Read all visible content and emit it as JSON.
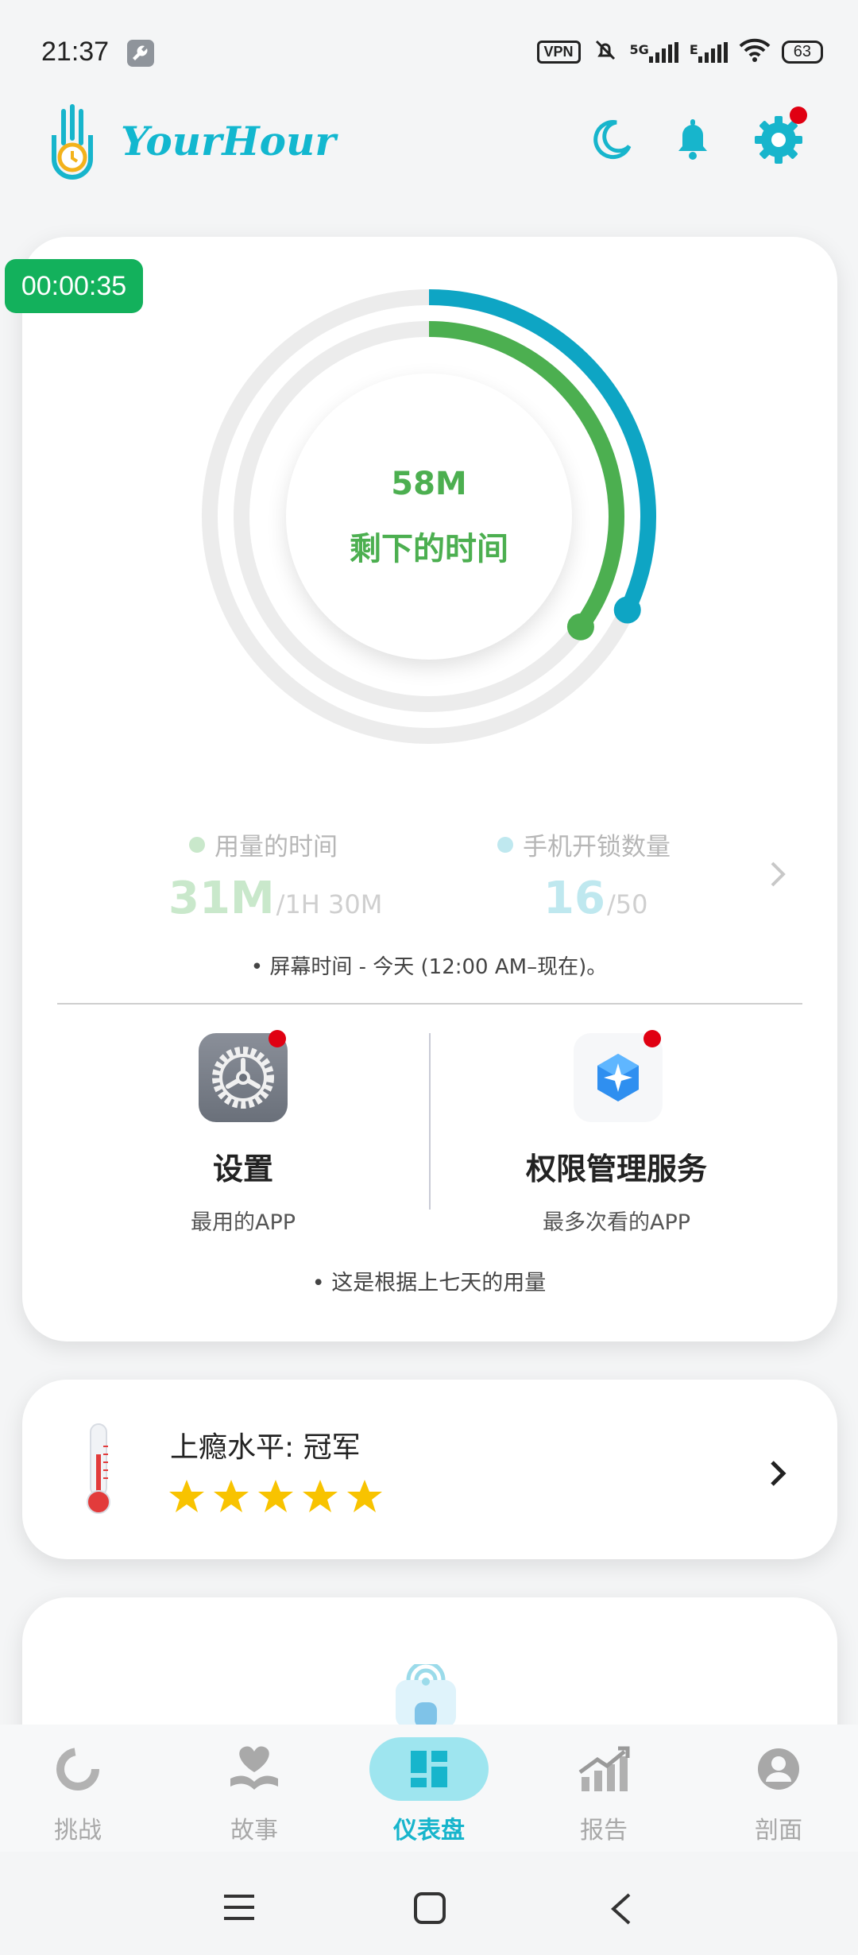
{
  "status_bar": {
    "time": "21:37",
    "vpn": "VPN",
    "network": "5G",
    "network2": "E",
    "battery": "63"
  },
  "header": {
    "app_name": "YourHour"
  },
  "dashboard": {
    "timer": "00:00:35",
    "gauge_value": "58M",
    "gauge_label": "剩下的时间",
    "usage_label": "用量的时间",
    "usage_value": "31M",
    "usage_limit": "/1H 30M",
    "unlock_label": "手机开锁数量",
    "unlock_value": "16",
    "unlock_limit": "/50",
    "screen_note": "• 屏幕时间 - 今天 (12:00 AM–现在)。",
    "top_app_name": "设置",
    "top_app_sub": "最用的APP",
    "viewed_app_name": "权限管理服务",
    "viewed_app_sub": "最多次看的APP",
    "week_note": "• 这是根据上七天的用量",
    "usage_fraction": 0.35,
    "unlock_fraction": 0.32
  },
  "addiction": {
    "title": "上瘾水平: 冠军",
    "stars": 5
  },
  "nav": {
    "items": [
      {
        "label": "挑战"
      },
      {
        "label": "故事"
      },
      {
        "label": "仪表盘"
      },
      {
        "label": "报告"
      },
      {
        "label": "剖面"
      }
    ]
  },
  "colors": {
    "accent": "#17b5cc",
    "green": "#4caf50",
    "timer": "#13b15c",
    "teal_ring": "#0ea5c4"
  }
}
